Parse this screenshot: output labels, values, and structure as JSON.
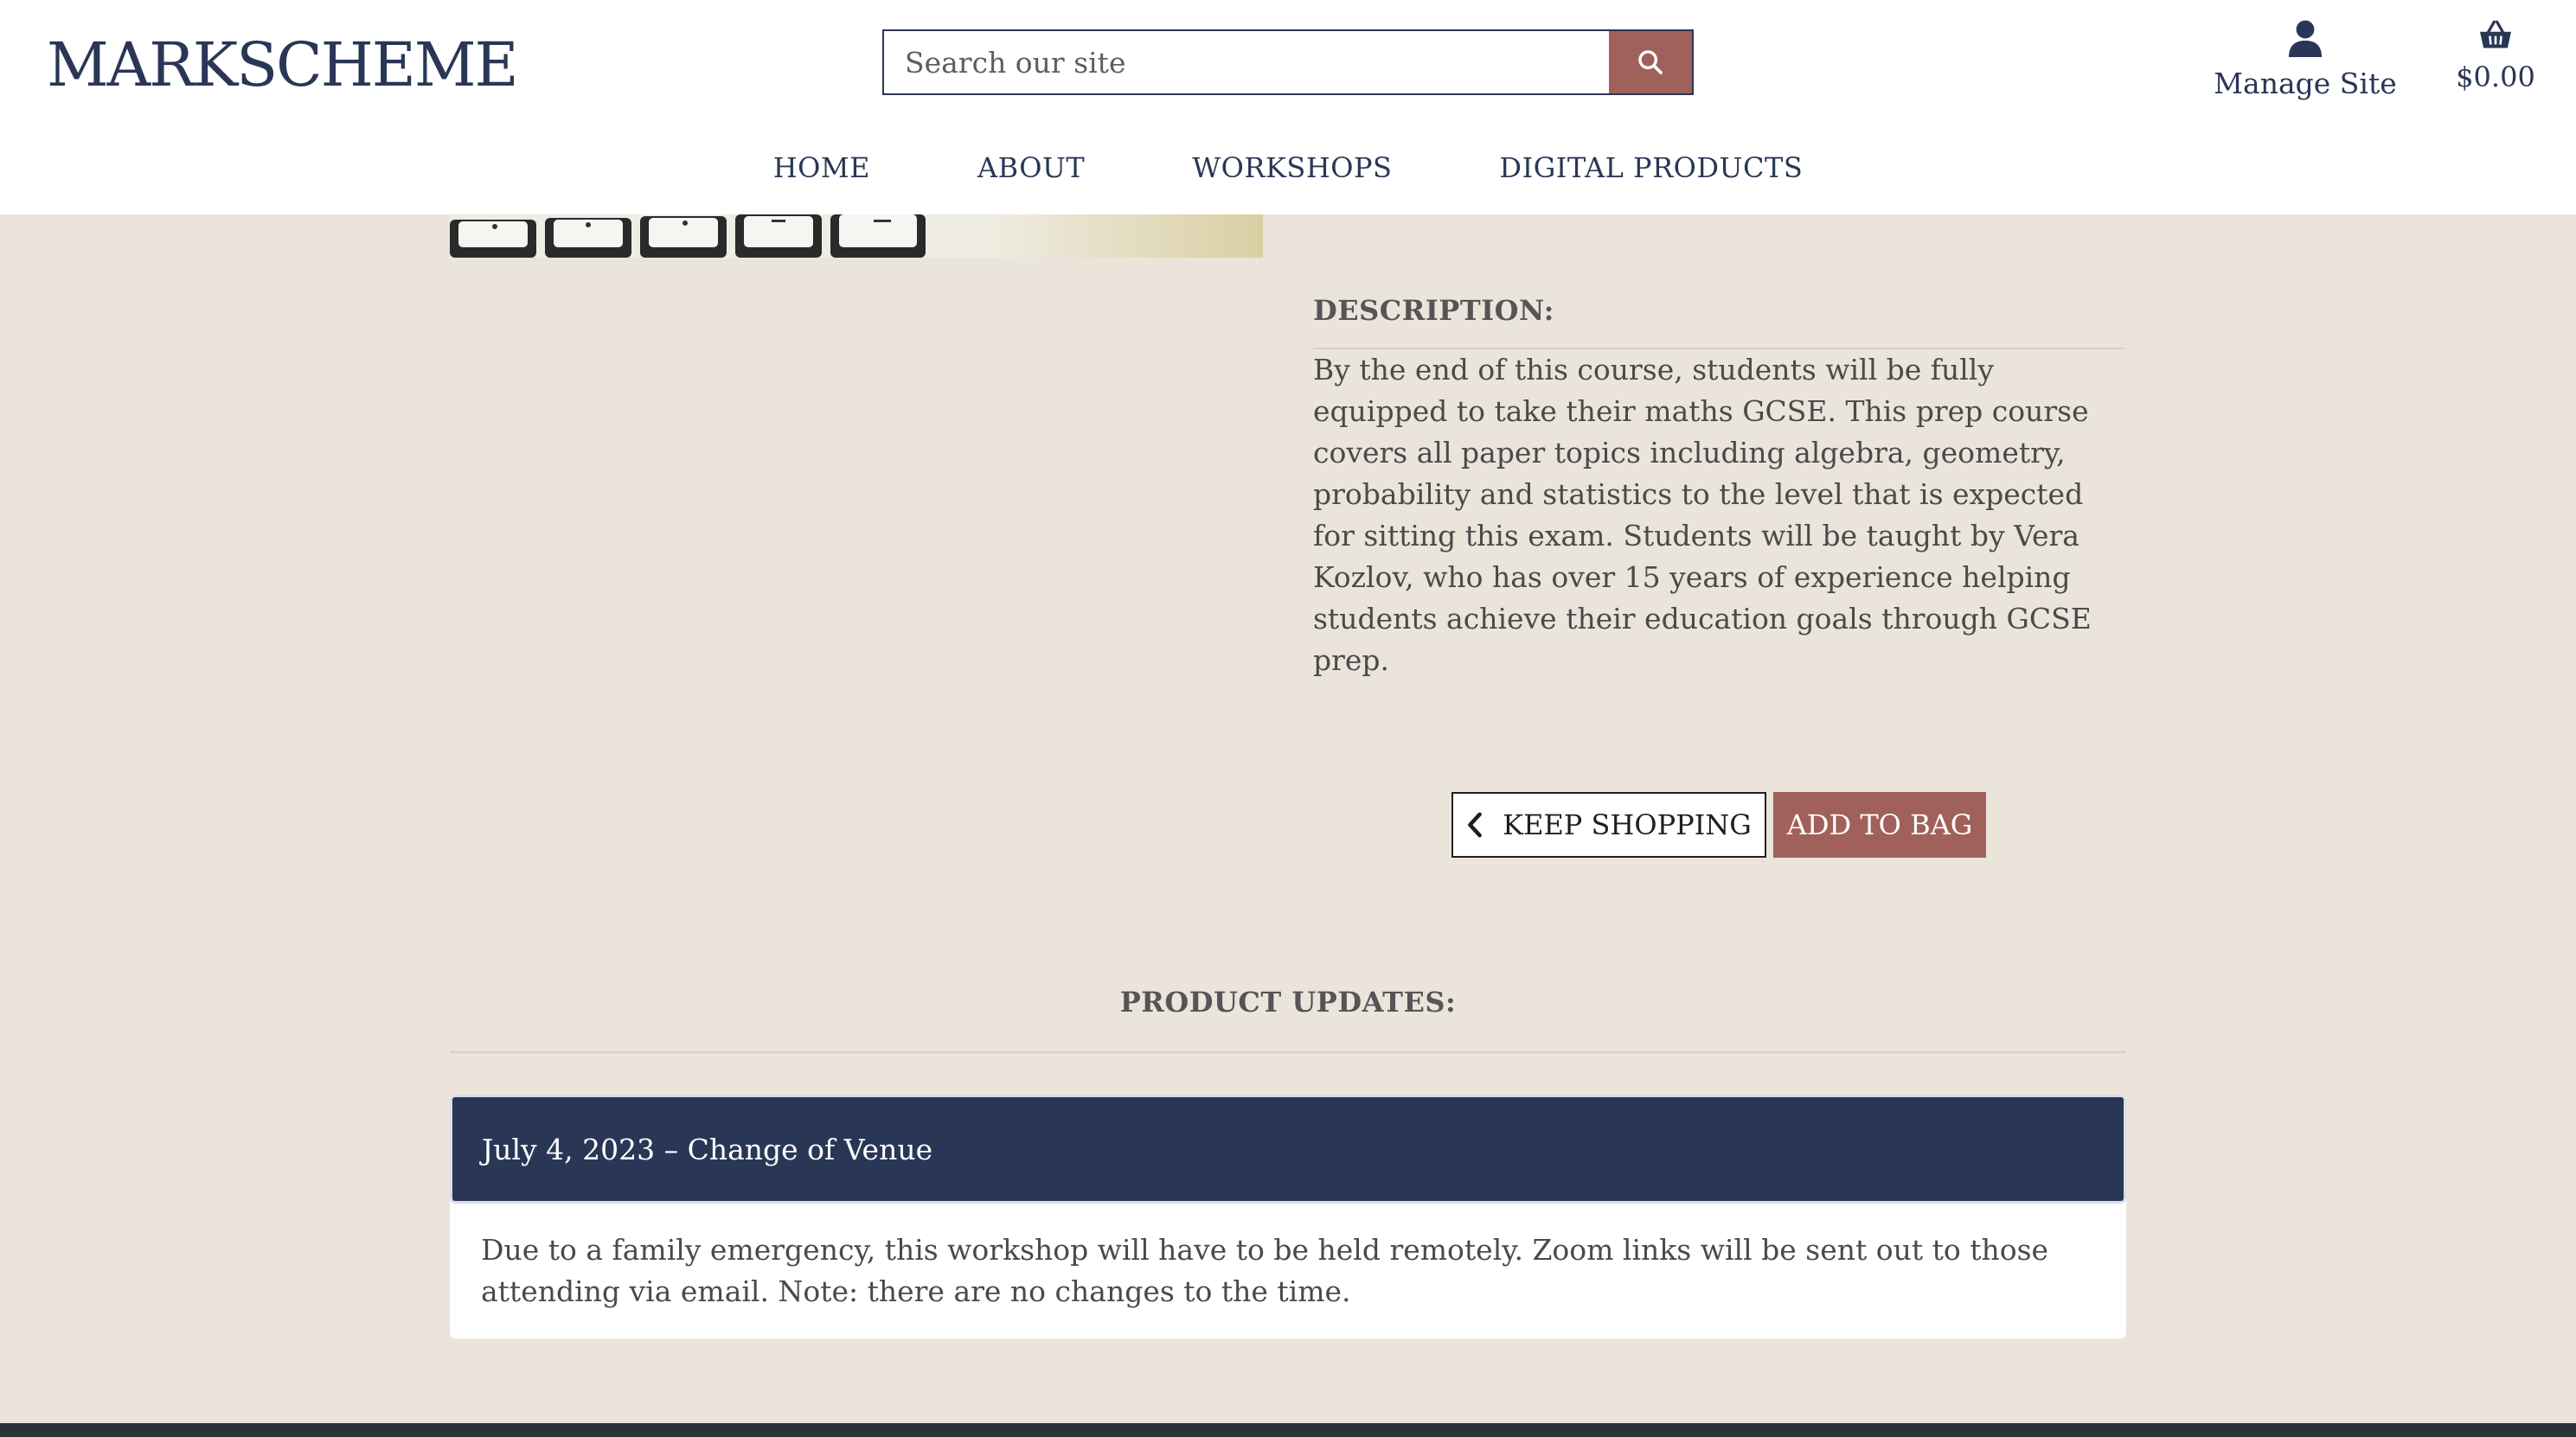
{
  "header": {
    "logo": "MARKSCHEME",
    "search_placeholder": "Search our site",
    "manage_label": "Manage Site",
    "cart_total": "$0.00",
    "search_icon": "search-icon",
    "account_icon": "user-icon",
    "cart_icon": "basket-icon"
  },
  "nav": {
    "items": [
      "HOME",
      "ABOUT",
      "WORKSHOPS",
      "DIGITAL PRODUCTS"
    ]
  },
  "product": {
    "description_title": "DESCRIPTION:",
    "description": "By the end of this course, students will be fully equipped to take their maths GCSE. This prep course covers all paper topics including algebra, geometry, probability and statistics to the level that is expected for sitting this exam. Students will be taught by Vera Kozlov, who has over 15 years of experience helping students achieve their education goals through GCSE prep.",
    "keep_shopping_label": "KEEP SHOPPING",
    "add_to_bag_label": "ADD TO BAG"
  },
  "updates": {
    "title": "PRODUCT UPDATES:",
    "items": [
      {
        "heading": "July 4, 2023 – Change of Venue",
        "body": "Due to a family emergency, this workshop will have to be held remotely. Zoom links will be sent out to those attending via email. Note: there are no changes to the time."
      }
    ]
  },
  "colors": {
    "brand_navy": "#2a3656",
    "accent_rose": "#a0615b",
    "page_bg": "#ebe4db"
  }
}
